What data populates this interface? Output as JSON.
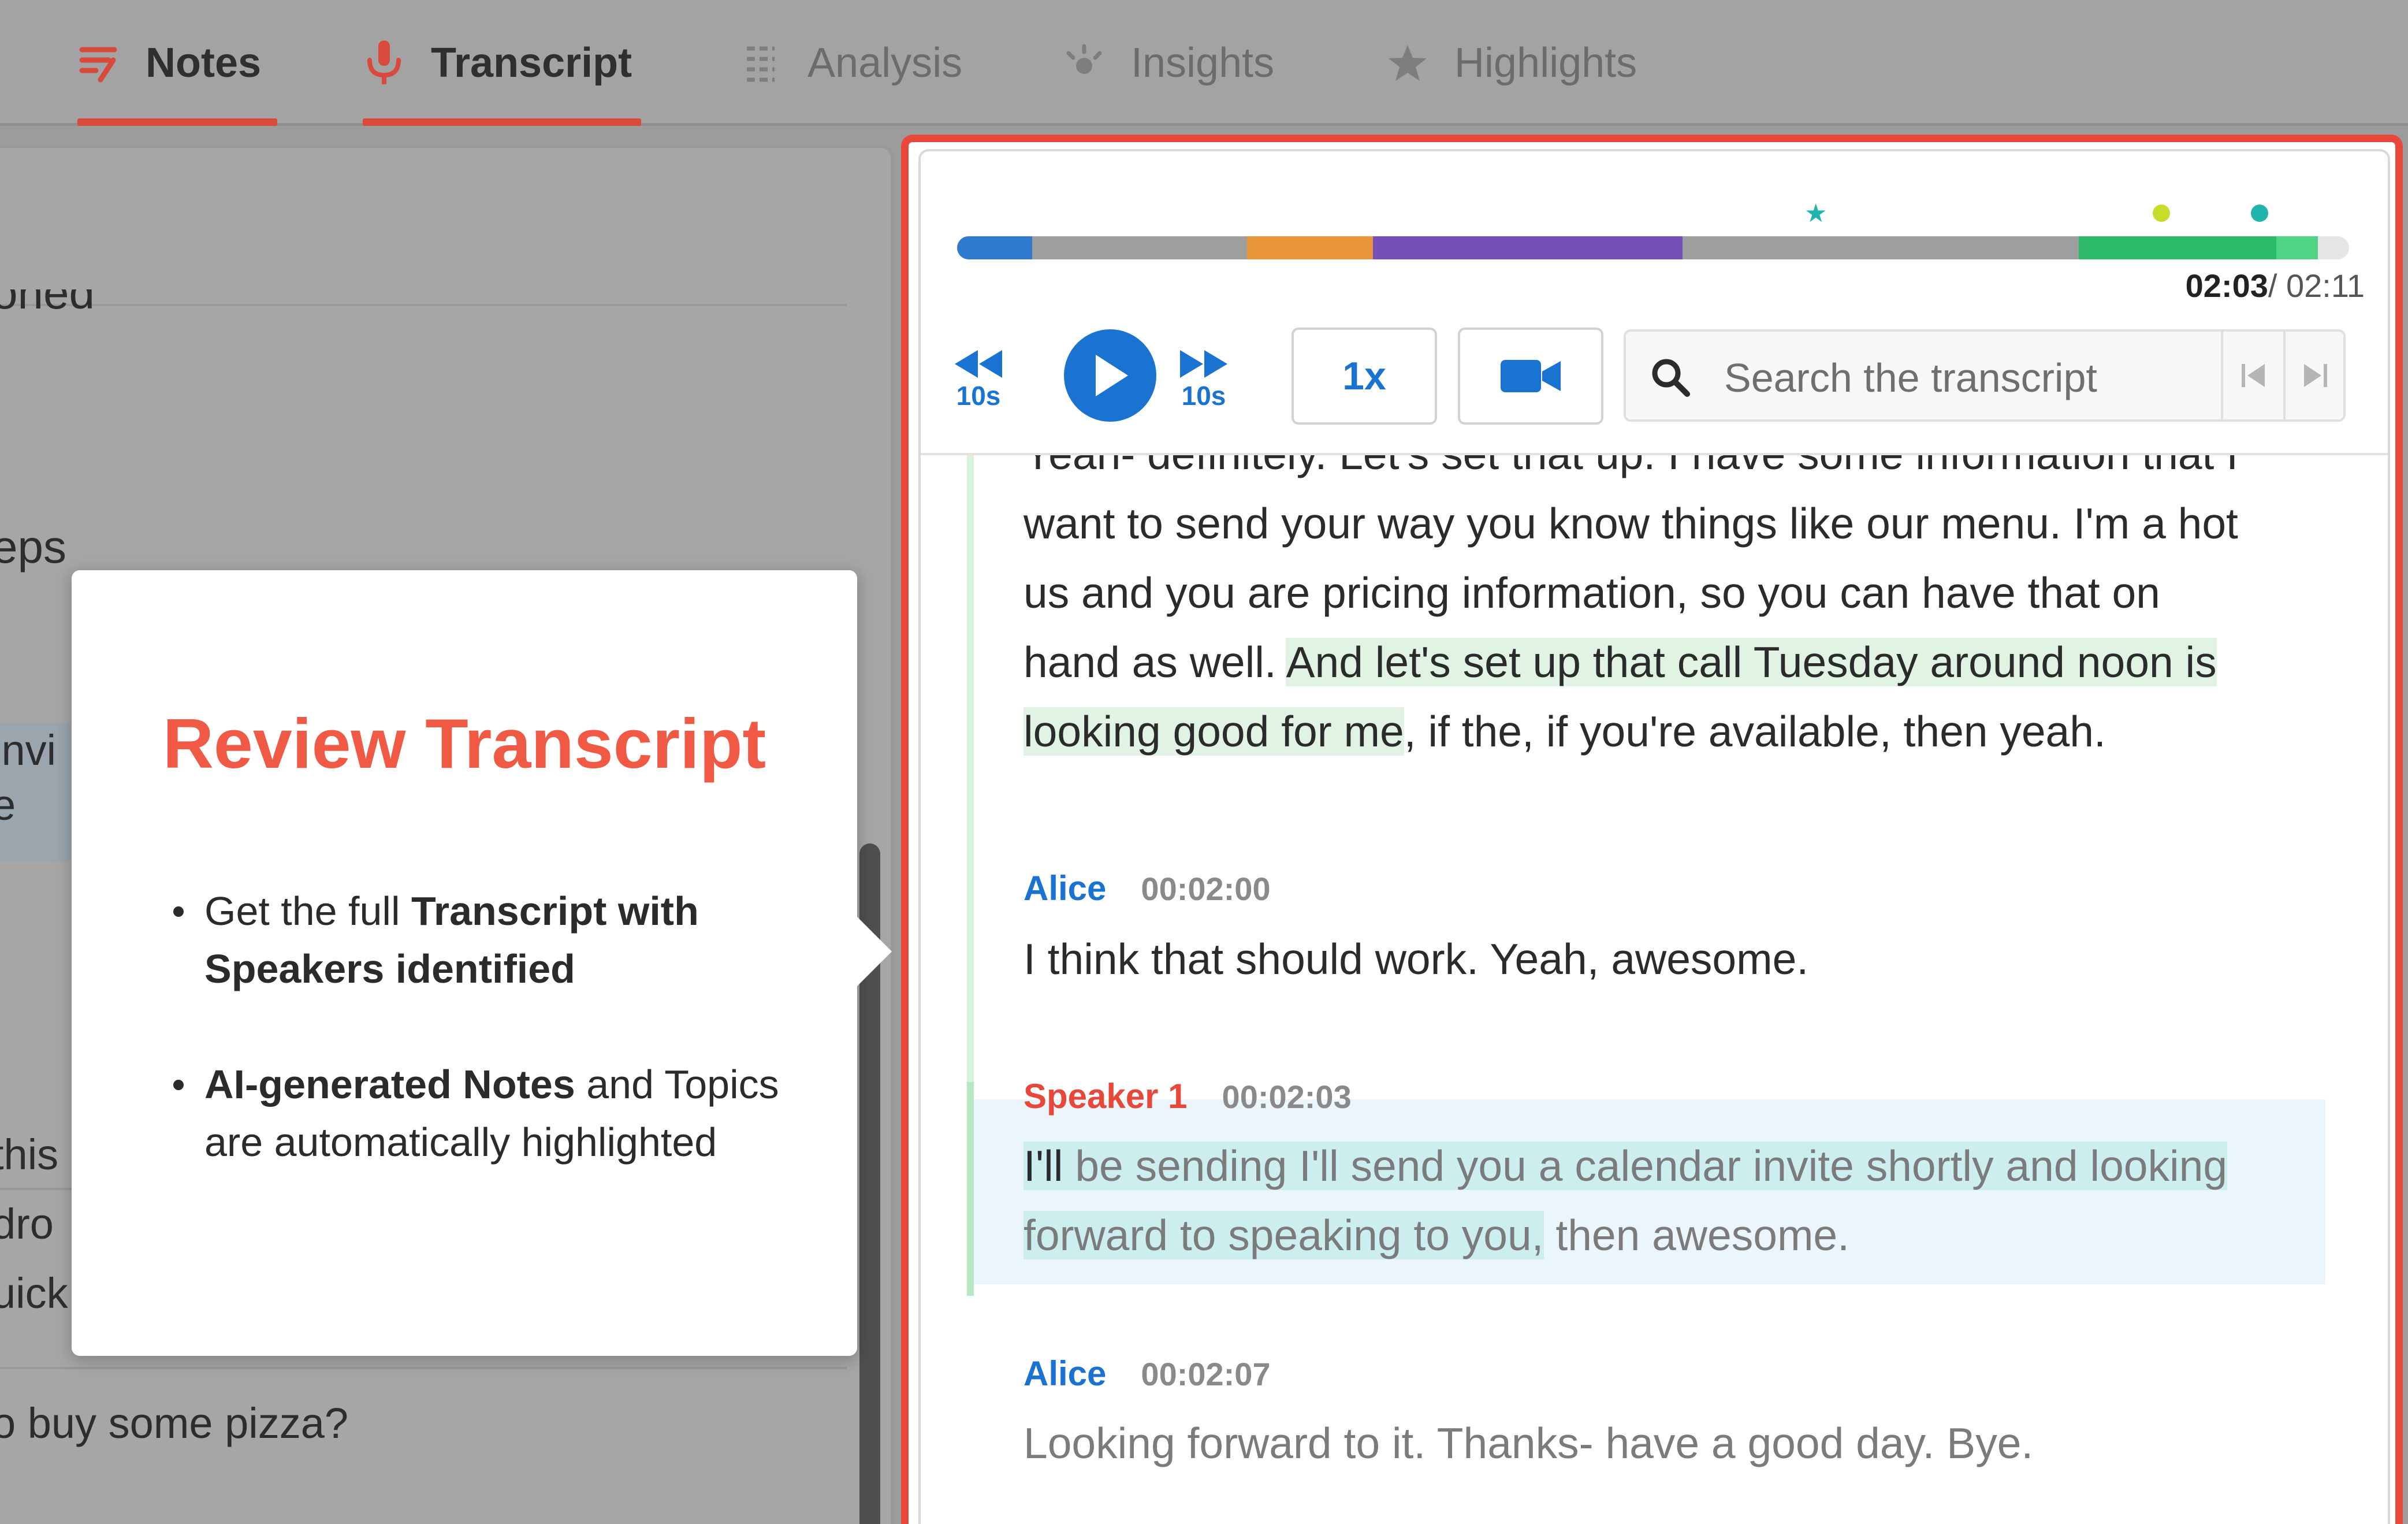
{
  "tabs": [
    {
      "label": "Notes",
      "icon": "notes-icon",
      "active": true
    },
    {
      "label": "Transcript",
      "icon": "microphone-icon",
      "active": true
    },
    {
      "label": "Analysis",
      "icon": "analysis-icon",
      "active": false
    },
    {
      "label": "Insights",
      "icon": "insights-icon",
      "active": false
    },
    {
      "label": "Highlights",
      "icon": "star-icon",
      "active": false
    }
  ],
  "left_panel": {
    "fragments": [
      "oned",
      "eps",
      "invi",
      "e",
      "this",
      "dro",
      "uick",
      "o buy some pizza?"
    ]
  },
  "tooltip": {
    "title": "Review Transcript",
    "bullet1_pre": "Get the full ",
    "bullet1_bold": "Transcript with Speakers identified",
    "bullet2_bold": "AI-generated Notes",
    "bullet2_post": " and Topics are automatically highlighted"
  },
  "player": {
    "current_time": "02:03",
    "total_time": "/ 02:11",
    "rewind_label": "10s",
    "forward_label": "10s",
    "speed_label": "1x",
    "search_placeholder": "Search the transcript",
    "progress_fraction": 0.9389,
    "colors": {
      "accent": "#1a73d1",
      "focus_frame": "#e8483a",
      "speaker_alice": "#1a73d1",
      "speaker_1": "#e8483a"
    }
  },
  "transcript": {
    "partial_top": "Yeah- definitely. Let's set that up. I have some information that I",
    "block1": {
      "line_a": "want to send your way you know things like our menu. I'm a hot",
      "line_b": "us and you are pricing information, so you can have that on",
      "line_c_plain": "hand as well. ",
      "line_c_hl": "And let's set up that call Tuesday around noon is",
      "line_d_hl": "looking good for me",
      "line_d_plain": ", if the, if you're available, then yeah."
    },
    "entries": [
      {
        "speaker": "Alice",
        "timestamp": "00:02:00",
        "text": "I think that should work. Yeah, awesome."
      },
      {
        "speaker": "Speaker 1",
        "timestamp": "00:02:03",
        "word_active": "I'll",
        "hl_a": " be sending I'll send you a calendar invite shortly and looking",
        "hl_b": "forward to speaking to you,",
        "tail": " then awesome."
      },
      {
        "speaker": "Alice",
        "timestamp": "00:02:07",
        "text": "Looking forward to it. Thanks- have a good day. Bye."
      }
    ]
  }
}
